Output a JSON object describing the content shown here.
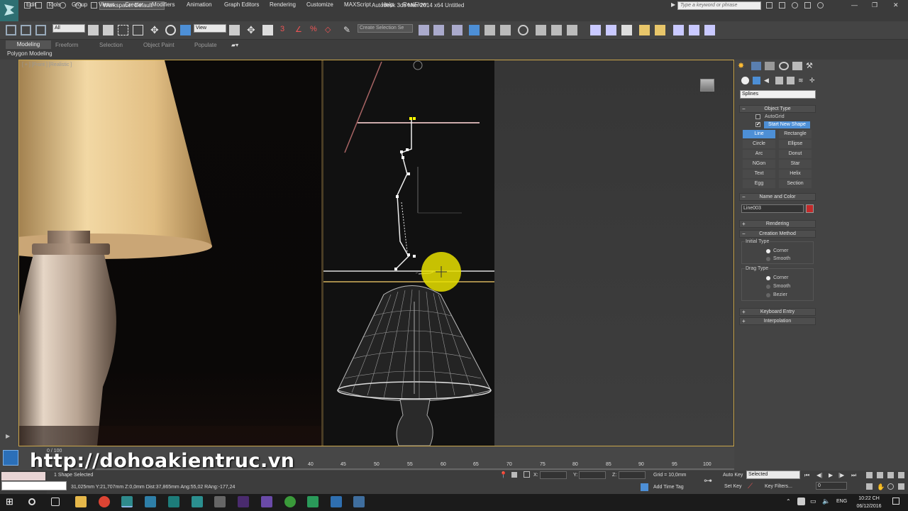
{
  "titlebar": {
    "workspace": "Workspace: Default",
    "title": "Autodesk 3ds Max  2014 x64      Untitled",
    "search_placeholder": "Type a keyword or phrase"
  },
  "menu": [
    "Edit",
    "Tools",
    "Group",
    "Views",
    "Create",
    "Modifiers",
    "Animation",
    "Graph Editors",
    "Rendering",
    "Customize",
    "MAXScript",
    "Help",
    "RealFlow"
  ],
  "toolbar": {
    "selection_filter": "All",
    "reference_coord": "View",
    "named_selection": "Create Selection Se"
  },
  "ribbon": {
    "tabs": [
      "Modeling",
      "Freeform",
      "Selection",
      "Object Paint",
      "Populate"
    ],
    "sub_label": "Polygon Modeling"
  },
  "viewport": {
    "label": "[ + ] [Front ] [Realistic ]"
  },
  "command_panel": {
    "category": "Splines",
    "object_type": {
      "title": "Object Type",
      "autogrid": "AutoGrid",
      "start_new_shape": "Start New Shape",
      "buttons": [
        "Line",
        "Rectangle",
        "Circle",
        "Ellipse",
        "Arc",
        "Donut",
        "NGon",
        "Star",
        "Text",
        "Helix",
        "Egg",
        "Section"
      ]
    },
    "name_and_color": {
      "title": "Name and Color",
      "name": "Line003",
      "color": "#c22a2a"
    },
    "rendering_title": "Rendering",
    "creation_method": {
      "title": "Creation Method",
      "initial_type": "Initial Type",
      "initial_options": [
        "Corner",
        "Smooth"
      ],
      "drag_type": "Drag Type",
      "drag_options": [
        "Corner",
        "Smooth",
        "Bezier"
      ]
    },
    "keyboard_entry": "Keyboard Entry",
    "interpolation": "Interpolation"
  },
  "timeline": {
    "slider": "0 / 100",
    "ruler": [
      "40",
      "45",
      "50",
      "55",
      "60",
      "65",
      "70",
      "75",
      "80",
      "85",
      "90",
      "95",
      "100"
    ]
  },
  "status": {
    "selection": "1 Shape Selected",
    "prompt": "31,025mm  Y:21,707mm  Z:0,0mm  Dist:37,865mm  Ang:55,02  RAng:-177,24",
    "x_label": "X:",
    "y_label": "Y:",
    "z_label": "Z:",
    "grid": "Grid = 10,0mm",
    "add_time_tag": "Add Time Tag",
    "auto_key": "Auto Key",
    "set_key": "Set Key",
    "selected": "Selected",
    "key_filters": "Key Filters...",
    "frame": "0"
  },
  "watermark": "http://dohoakientruc.vn",
  "taskbar": {
    "lang": "ENG",
    "time": "10:22 CH",
    "date": "06/12/2016"
  }
}
